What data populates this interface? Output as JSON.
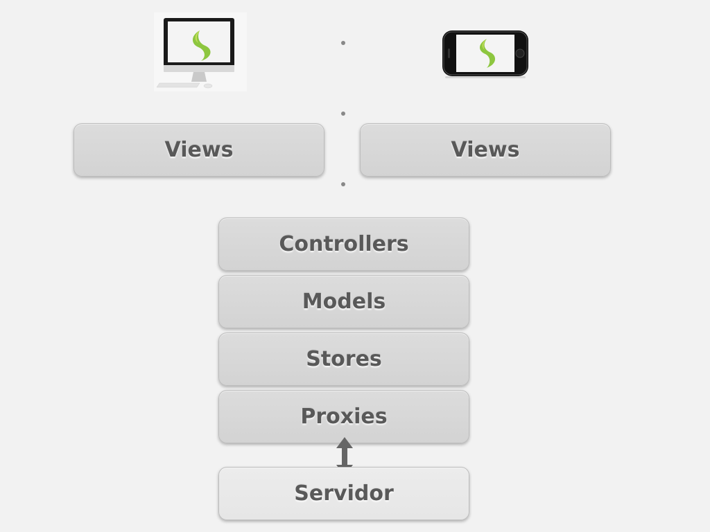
{
  "devices": {
    "desktop": {
      "icon": "imac-desktop-icon",
      "logo_color": "#8dc63f"
    },
    "mobile": {
      "icon": "iphone-mobile-icon",
      "logo_color": "#8dc63f"
    }
  },
  "views": {
    "left_label": "Views",
    "right_label": "Views"
  },
  "stack": {
    "controllers": "Controllers",
    "models": "Models",
    "stores": "Stores",
    "proxies": "Proxies"
  },
  "server": {
    "label": "Servidor"
  },
  "connector": {
    "icon": "double-arrow-vertical-icon",
    "color": "#666666"
  }
}
